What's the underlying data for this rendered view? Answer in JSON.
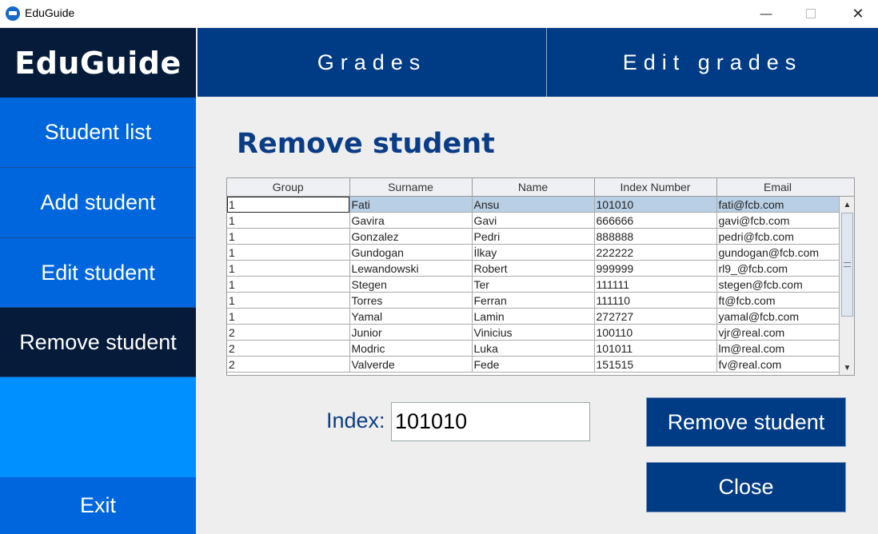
{
  "window": {
    "title": "EduGuide",
    "minimize_glyph": "—",
    "close_glyph": "✕"
  },
  "sidebar": {
    "logo": "EduGuide",
    "items": [
      {
        "label": "Student list"
      },
      {
        "label": "Add student"
      },
      {
        "label": "Edit student"
      },
      {
        "label": "Remove student",
        "active": true
      }
    ],
    "exit_label": "Exit"
  },
  "topnav": {
    "grades_label": "Grades",
    "edit_grades_label": "Edit grades"
  },
  "main": {
    "title": "Remove student",
    "table": {
      "columns": [
        "Group",
        "Surname",
        "Name",
        "Index Number",
        "Email"
      ],
      "rows": [
        [
          "1",
          "Fati",
          "Ansu",
          "101010",
          "fati@fcb.com"
        ],
        [
          "1",
          "Gavira",
          "Gavi",
          "666666",
          "gavi@fcb.com"
        ],
        [
          "1",
          "Gonzalez",
          "Pedri",
          "888888",
          "pedri@fcb.com"
        ],
        [
          "1",
          "Gundogan",
          "İlkay",
          "222222",
          "gundogan@fcb.com"
        ],
        [
          "1",
          "Lewandowski",
          "Robert",
          "999999",
          "rl9_@fcb.com"
        ],
        [
          "1",
          "Stegen",
          "Ter",
          "111111",
          "stegen@fcb.com"
        ],
        [
          "1",
          "Torres",
          "Ferran",
          "111110",
          "ft@fcb.com"
        ],
        [
          "1",
          "Yamal",
          "Lamin",
          "272727",
          "yamal@fcb.com"
        ],
        [
          "2",
          "Junior",
          "Vinicius",
          "100110",
          "vjr@real.com"
        ],
        [
          "2",
          "Modric",
          "Luka",
          "101011",
          "lm@real.com"
        ],
        [
          "2",
          "Valverde",
          "Fede",
          "151515",
          "fv@real.com"
        ]
      ],
      "selected_row": 0
    },
    "index_label": "Index:",
    "index_value": "101010",
    "remove_button": "Remove student",
    "close_button": "Close"
  },
  "colors": {
    "sidebar_item": "#0066dd",
    "sidebar_active": "#061b3a",
    "sidebar_fill": "#0090ff",
    "topnav": "#003b85",
    "title_text": "#0b3d86",
    "selected_row": "#b8cfe5"
  },
  "icons": {
    "app": "graduation-cap-icon",
    "scroll_up": "triangle-up-icon",
    "scroll_down": "triangle-down-icon"
  }
}
